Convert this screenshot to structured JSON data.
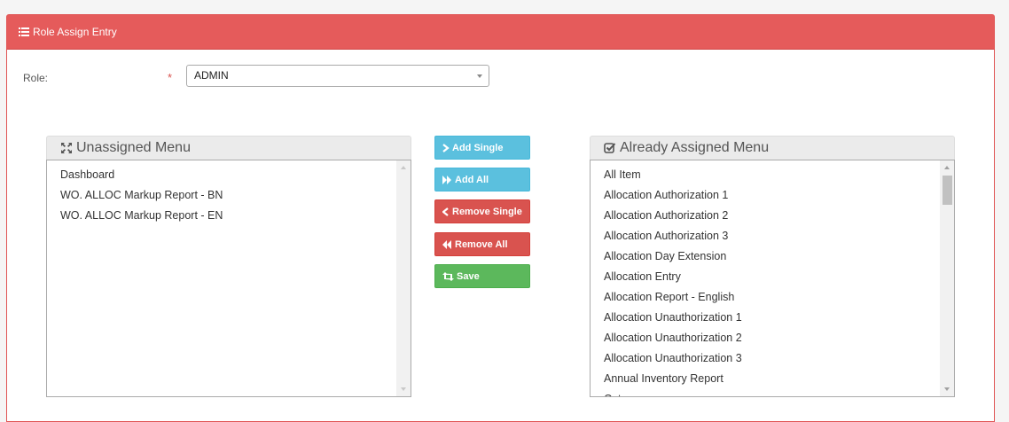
{
  "panel": {
    "title": "Role Assign Entry"
  },
  "role": {
    "label": "Role:",
    "required_mark": "*",
    "selected": "ADMIN"
  },
  "unassigned": {
    "title": "Unassigned Menu",
    "items": [
      "Dashboard",
      "WO. ALLOC Markup Report - BN",
      "WO. ALLOC Markup Report - EN"
    ]
  },
  "assigned": {
    "title": "Already Assigned Menu",
    "items": [
      "All Item",
      "Allocation Authorization 1",
      "Allocation Authorization 2",
      "Allocation Authorization 3",
      "Allocation Day Extension",
      "Allocation Entry",
      "Allocation Report - English",
      "Allocation Unauthorization 1",
      "Allocation Unauthorization 2",
      "Allocation Unauthorization 3",
      "Annual Inventory Report",
      "Category"
    ]
  },
  "buttons": {
    "add_single": "Add Single",
    "add_all": "Add All",
    "remove_single": "Remove Single",
    "remove_all": "Remove All",
    "save": "Save"
  },
  "icons": [
    "list-icon",
    "expand-icon",
    "check-square-icon",
    "chevron-right-icon",
    "double-chevron-right-icon",
    "chevron-left-icon",
    "double-chevron-left-icon",
    "retweet-icon"
  ],
  "colors": {
    "header": "#e55b5b",
    "info": "#5bc0de",
    "danger": "#d9534f",
    "success": "#5cb85c"
  }
}
